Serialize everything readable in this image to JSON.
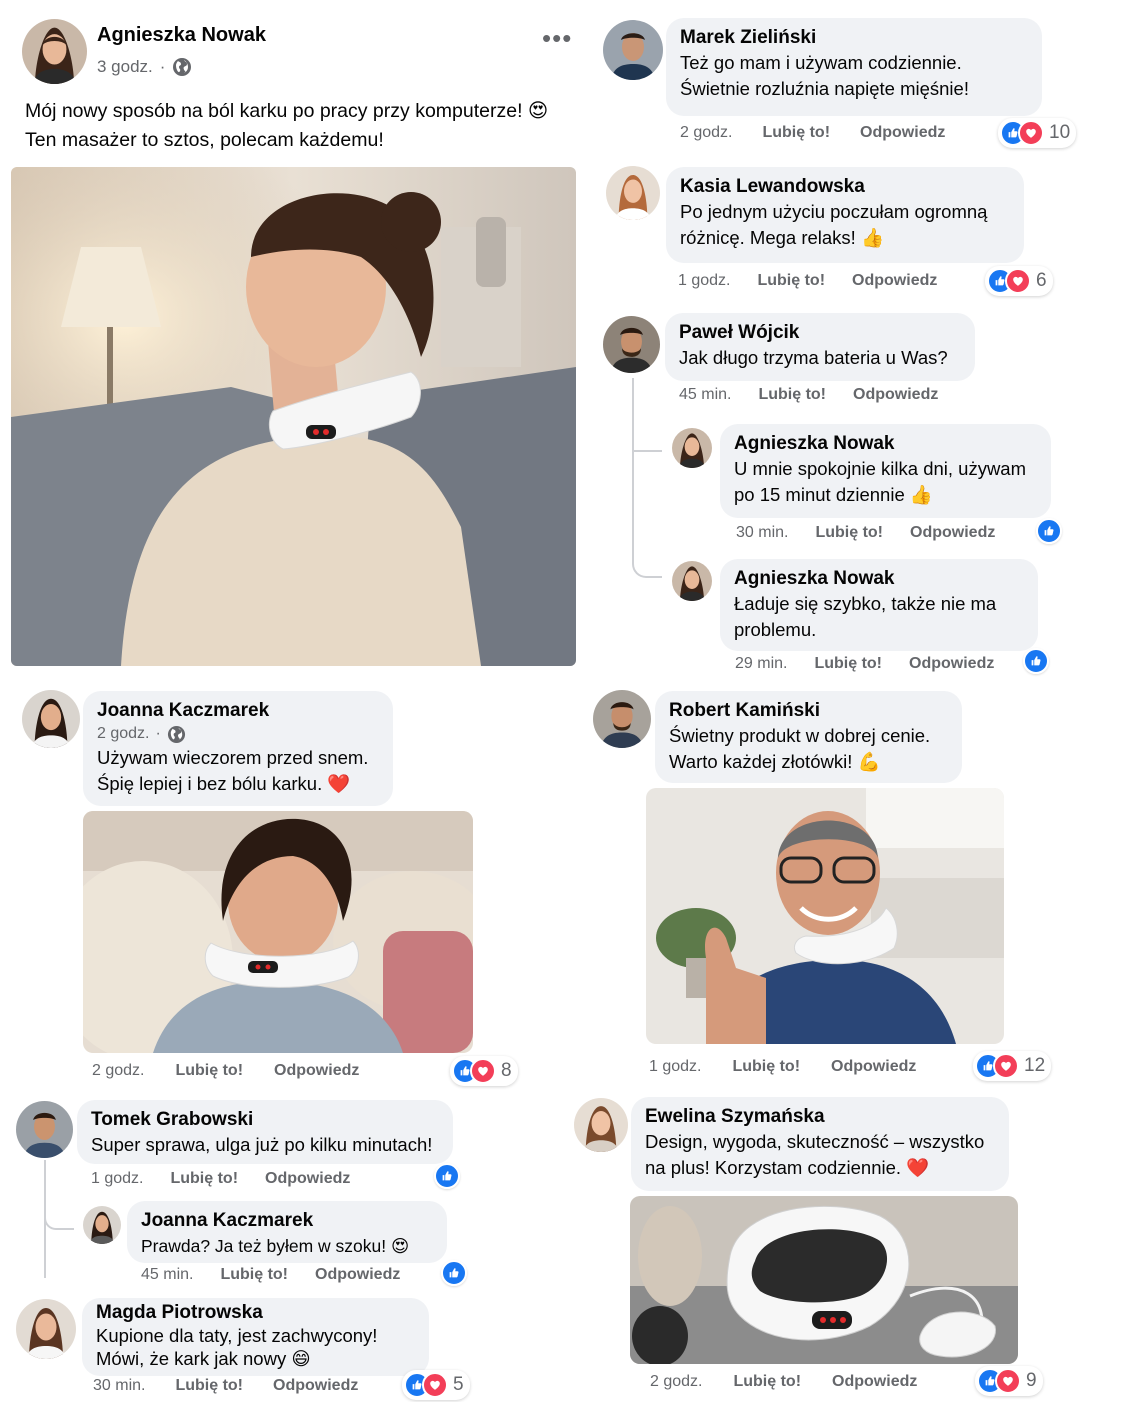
{
  "post": {
    "author": "Agnieszka Nowak",
    "time": "3 godz.",
    "separator": "·",
    "more_icon": "more-horizontal-icon",
    "text_line1": "Mój nowy sposób na ból karku po pracy przy komputerze!",
    "text_line2": "Ten masażer to sztos, polecam każdemu!",
    "emoji": "😍"
  },
  "actions": {
    "like": "Lubię to!",
    "reply": "Odpowiedz"
  },
  "colors": {
    "like_blue": "#1877f2",
    "love_red": "#f33e58",
    "bubble_bg": "#f0f2f5",
    "muted": "#65676b"
  },
  "comments": [
    {
      "name": "Marek Zieliński",
      "lines": [
        "Też go mam i używam codziennie.",
        "Świetnie rozluźnia napięte mięśnie!"
      ],
      "time": "2 godz.",
      "reactions": 10
    },
    {
      "name": "Kasia Lewandowska",
      "lines": [
        "Po jednym użyciu poczułam ogromną",
        "różnicę. Mega relaks!"
      ],
      "emoji": "👍",
      "time": "1 godz.",
      "reactions": 6
    },
    {
      "name": "Paweł Wójcik",
      "lines": [
        "Jak długo trzyma bateria u Was?"
      ],
      "time": "45 min.",
      "replies": [
        {
          "name": "Agnieszka Nowak",
          "lines": [
            "U mnie spokojnie kilka dni, używam",
            "po 15 minut dziennie"
          ],
          "emoji": "👍",
          "time": "30 min."
        },
        {
          "name": "Agnieszka Nowak",
          "lines": [
            "Ładuje się szybko, także nie ma",
            "problemu."
          ],
          "time": "29 min."
        }
      ]
    },
    {
      "name": "Joanna Kaczmarek",
      "time_top": "2 godz.",
      "lines": [
        "Używam wieczorem przed snem.",
        "Śpię lepiej i bez bólu karku."
      ],
      "emoji": "❤️",
      "time": "2 godz.",
      "reactions": 8
    },
    {
      "name": "Robert Kamiński",
      "lines": [
        "Świetny produkt w dobrej cenie.",
        "Warto każdej złotówki!"
      ],
      "emoji": "💪",
      "time": "1 godz.",
      "reactions": 12
    },
    {
      "name": "Tomek Grabowski",
      "lines": [
        "Super sprawa, ulga już po kilku minutach!"
      ],
      "time": "1 godz.",
      "replies": [
        {
          "name": "Joanna Kaczmarek",
          "lines": [
            "Prawda? Ja też byłem w szoku!"
          ],
          "emoji": "😍",
          "time": "45 min."
        }
      ]
    },
    {
      "name": "Ewelina Szymańska",
      "lines": [
        "Design, wygoda, skuteczność – wszystko",
        "na plus! Korzystam codziennie."
      ],
      "emoji": "❤️",
      "time": "2 godz.",
      "reactions": 9
    },
    {
      "name": "Magda Piotrowska",
      "lines": [
        "Kupione dla taty, jest zachwycony!",
        "Mówi, że kark jak nowy"
      ],
      "emoji": "😄",
      "time": "30 min.",
      "reactions": 5
    }
  ]
}
